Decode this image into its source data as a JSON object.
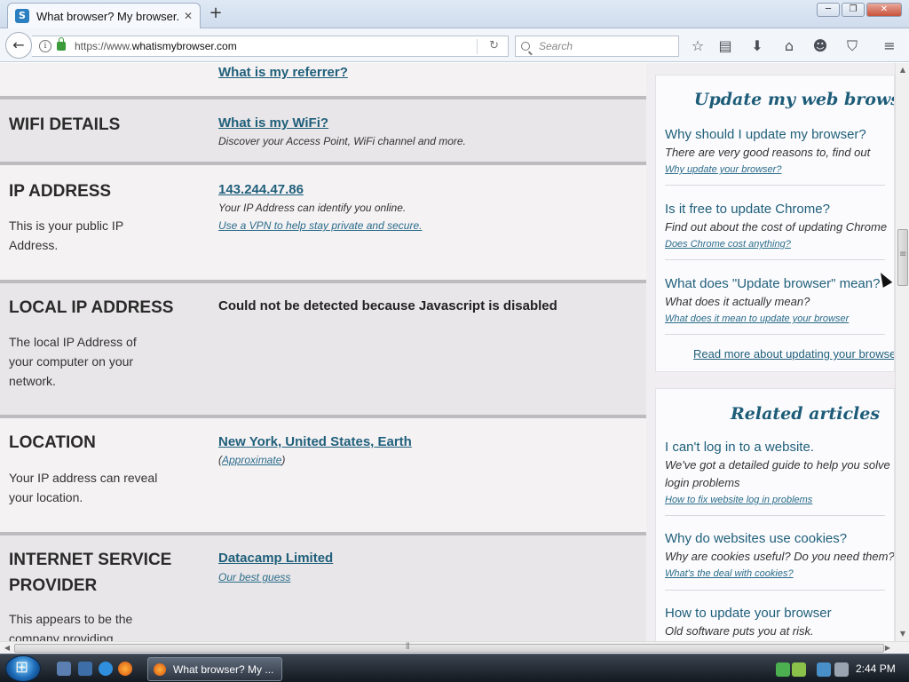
{
  "browser": {
    "tab_title": "What browser? My browser...",
    "tab_favicon_letter": "S",
    "new_tab_label": "+",
    "url_prefix": "https://www.",
    "url_domain": "whatismybrowser.com",
    "search_placeholder": "Search",
    "window_controls": {
      "minimize": "─",
      "maximize": "❐",
      "close": "✕"
    }
  },
  "page": {
    "top_link": "What is my referrer?",
    "rows": [
      {
        "title": "WIFI DETAILS",
        "value": "What is my WiFi?",
        "note": "Discover your Access Point, WiFi channel and more."
      },
      {
        "title": "IP ADDRESS",
        "desc": "This is your public IP Address.",
        "value": "143.244.47.86",
        "note": "Your IP Address can identify you online.",
        "note_link": "Use a VPN to help stay private and secure."
      },
      {
        "title": "LOCAL IP ADDRESS",
        "desc": "The local IP Address of your computer on your network.",
        "value": "Could not be detected because Javascript is disabled"
      },
      {
        "title": "LOCATION",
        "desc": "Your IP address can reveal your location.",
        "value": "New York, United States, Earth",
        "note_pre": "(",
        "note_link": "Approximate",
        "note_post": ")"
      },
      {
        "title": "INTERNET SERVICE PROVIDER",
        "desc": "This appears to be the company providing",
        "value": "Datacamp Limited",
        "note_link": "Our best guess"
      }
    ]
  },
  "sidebar": {
    "update": {
      "title": "Update my web browser",
      "articles": [
        {
          "question": "Why should I update my browser?",
          "answer": "There are very good reasons to, find out",
          "link": "Why update your browser?"
        },
        {
          "question": "Is it free to update Chrome?",
          "answer": "Find out about the cost of updating Chrome",
          "link": "Does Chrome cost anything?"
        },
        {
          "question": "What does \"Update browser\" mean?",
          "answer": "What does it actually mean?",
          "link": "What does it mean to update your browser"
        }
      ],
      "read_more": "Read more about updating your browser"
    },
    "related": {
      "title": "Related articles",
      "articles": [
        {
          "question": "I can't log in to a website.",
          "answer": "We've got a detailed guide to help you solve login problems",
          "link": "How to fix website log in problems"
        },
        {
          "question": "Why do websites use cookies?",
          "answer": "Why are cookies useful? Do you need them?",
          "link": "What's the deal with cookies?"
        },
        {
          "question": "How to update your browser",
          "answer": "Old software puts you at risk."
        }
      ]
    }
  },
  "taskbar": {
    "task_label": "What browser? My ...",
    "clock": "2:44 PM"
  },
  "colors": {
    "link": "#1f5f7a",
    "sidebar_title": "#1d5c78",
    "row_light": "#f5f2f4",
    "row_grey": "#e8e6e8"
  },
  "icons": [
    "back-arrow-icon",
    "info-icon",
    "lock-icon",
    "reload-icon",
    "search-icon",
    "bookmark-star-icon",
    "reading-list-icon",
    "download-icon",
    "home-icon",
    "smiley-icon",
    "pocket-icon",
    "hamburger-menu-icon"
  ]
}
